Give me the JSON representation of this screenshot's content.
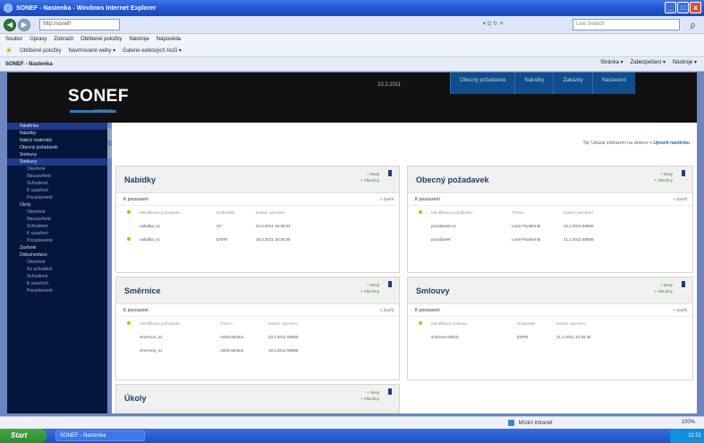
{
  "window": {
    "title": "SONEF - Nastenka - Windows Internet Explorer",
    "controls": [
      "_",
      "□",
      "x"
    ]
  },
  "address": {
    "url": "http://sonef/",
    "tools": "▾ ⊡ ↻ ✕",
    "search_placeholder": "Live Search",
    "search_go": "ρ"
  },
  "menu": [
    "Soubor",
    "Úpravy",
    "Zobrazit",
    "Oblíbené položky",
    "Nástroje",
    "Nápověda"
  ],
  "favorites": {
    "label": "Oblíbené položky",
    "items": [
      "Navrhované weby ▾",
      "Galerie webových řezů ▾"
    ]
  },
  "tab": {
    "label": "SONEF - Nastenka"
  },
  "commands": [
    "Stránka ▾",
    "Zabezpečení ▾",
    "Nástroje ▾"
  ],
  "app": {
    "logo": "SONEF",
    "logo_sub": "powered by",
    "date": "23.2.2011",
    "nav": [
      "Obecný požadavek",
      "Nabídky",
      "Zakázky",
      "Nastavení"
    ]
  },
  "sidebar": [
    {
      "label": "Nástěnka",
      "type": "active"
    },
    {
      "label": "Nabídky",
      "type": "group"
    },
    {
      "label": "Nabízí materiály",
      "type": "group"
    },
    {
      "label": "Obecný požadavek",
      "type": "group"
    },
    {
      "label": "Smlouvy",
      "type": "group"
    },
    {
      "label": "Smlouvy",
      "type": "active"
    },
    {
      "label": "Otevřené",
      "type": "sub"
    },
    {
      "label": "Neuzavřené",
      "type": "sub"
    },
    {
      "label": "Schválené",
      "type": "sub"
    },
    {
      "label": "K uzavření",
      "type": "sub"
    },
    {
      "label": "Pozastavené",
      "type": "sub"
    },
    {
      "label": "Úkoly",
      "type": "group"
    },
    {
      "label": "Otevřené",
      "type": "sub"
    },
    {
      "label": "Neuzavřené",
      "type": "sub"
    },
    {
      "label": "Schválené",
      "type": "sub"
    },
    {
      "label": "K uzavření",
      "type": "sub"
    },
    {
      "label": "Pozastavené",
      "type": "sub"
    },
    {
      "label": "Zavřené",
      "type": "group"
    },
    {
      "label": "Dokumentace",
      "type": "group"
    },
    {
      "label": "Otevřené",
      "type": "sub"
    },
    {
      "label": "Ke schválení",
      "type": "sub"
    },
    {
      "label": "Schválené",
      "type": "sub"
    },
    {
      "label": "K uzavření",
      "type": "sub"
    },
    {
      "label": "Pozastavené",
      "type": "sub"
    }
  ],
  "hint": {
    "text": "Tip: Ukázat zobrazení na stránce",
    "plus": "+",
    "link": "Upravit nástěnku"
  },
  "panels": {
    "nabidky": {
      "title": "Nabídky",
      "links": [
        "+ Nový",
        "+ Všechny"
      ],
      "sub_label": "K posouzení",
      "close": "× Zavřít",
      "columns": [
        "Identifikace požadavku",
        "Dodavatel",
        "Datum vytvoření"
      ],
      "rows": [
        {
          "name": "nabidka_s1",
          "who": "ZV",
          "date": "22.2.2011 16:30:03"
        },
        {
          "name": "nabidka_s1",
          "who": "EXPN",
          "date": "18.2.2011 10:30:35"
        }
      ]
    },
    "obecny": {
      "title": "Obecný požadavek",
      "links": [
        "+ Nový",
        "+ Všechny"
      ],
      "sub_label": "K posouzení",
      "close": "× Zavřít",
      "columns": [
        "Identifikace požadavku",
        "Tvůrce",
        "Datum vytvoření"
      ],
      "rows": [
        {
          "name": "pozadavek-s1",
          "who": "Lucie Pazdernik",
          "date": "22.2.2011 58666"
        },
        {
          "name": "pozadavek",
          "who": "Lucie Pazdernik",
          "date": "21.2.2011 58666"
        }
      ]
    },
    "smernice": {
      "title": "Směrnice",
      "links": [
        "+ Nový",
        "+ Všechny"
      ],
      "sub_label": "K posouzení",
      "close": "× Zavřít",
      "columns": [
        "Identifikace požadavku",
        "Tvůrce",
        "Datum vytvoření"
      ],
      "rows": [
        {
          "name": "smernice_s1",
          "who": "Administrator",
          "date": "23.2.2011 58666"
        },
        {
          "name": "smernice_s1",
          "who": "Administrator",
          "date": "19.2.2011 58666"
        }
      ]
    },
    "smlouvy": {
      "title": "Smlouvy",
      "links": [
        "+ Nový",
        "+ Všechny"
      ],
      "sub_label": "K posouzení",
      "close": "× Zavřít",
      "columns": [
        "Identifikace smlouvy",
        "Dodavatel",
        "Datum vytvoření"
      ],
      "rows": [
        {
          "name": "smlouva-s0818",
          "who": "EXPN",
          "date": "21.2.2011 10:30:35"
        }
      ]
    },
    "ukoly": {
      "title": "Úkoly",
      "links": [
        "+ Nový",
        "+ Všechny"
      ]
    }
  },
  "status": {
    "zone": "Místní intranet",
    "zoom": "100%"
  },
  "taskbar": {
    "start": "Start",
    "item": "SONEF - Nastenka",
    "clock": "11:21"
  }
}
